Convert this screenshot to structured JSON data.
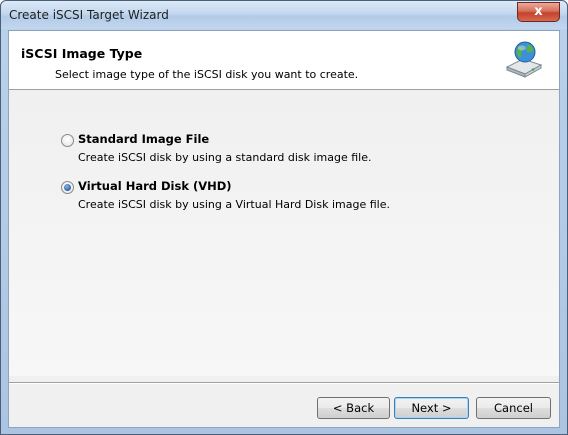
{
  "window": {
    "title": "Create iSCSI Target Wizard",
    "close_glyph": "x"
  },
  "header": {
    "title": "iSCSI Image Type",
    "subtitle": "Select image type of the iSCSI disk you want to create.",
    "icon": "globe-disk-icon"
  },
  "options": [
    {
      "label": "Standard Image File",
      "description": "Create iSCSI disk by using a standard disk image file.",
      "selected": false
    },
    {
      "label": "Virtual Hard Disk (VHD)",
      "description": "Create iSCSI disk by using a Virtual Hard Disk image file.",
      "selected": true
    }
  ],
  "buttons": {
    "back": "< Back",
    "next": "Next >",
    "cancel": "Cancel"
  },
  "colors": {
    "accent_radio": "#2a62ab",
    "close_button": "#c3422d",
    "default_button_border": "#3c7fb1"
  }
}
